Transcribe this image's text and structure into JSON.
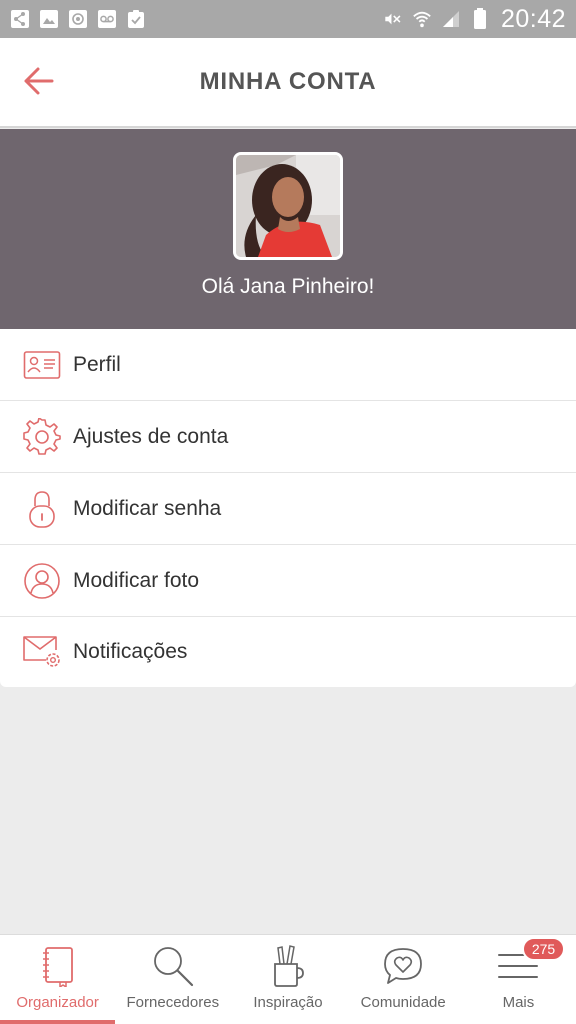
{
  "status_bar": {
    "time": "20:42",
    "left_icons": [
      "share-icon",
      "image-icon",
      "at-icon",
      "voicemail-icon",
      "clipboard-check-icon"
    ],
    "right_icons": [
      "mute-icon",
      "wifi-icon",
      "signal-icon",
      "battery-icon"
    ]
  },
  "header": {
    "title": "MINHA CONTA",
    "back_icon": "arrow-left-icon"
  },
  "profile": {
    "greeting": "Olá Jana Pinheiro!"
  },
  "menu": {
    "items": [
      {
        "label": "Perfil",
        "icon": "id-card-icon"
      },
      {
        "label": "Ajustes de conta",
        "icon": "gear-icon"
      },
      {
        "label": "Modificar senha",
        "icon": "lock-icon"
      },
      {
        "label": "Modificar foto",
        "icon": "user-circle-icon"
      },
      {
        "label": "Notificações",
        "icon": "mail-settings-icon"
      }
    ]
  },
  "bottom_nav": {
    "items": [
      {
        "label": "Organizador",
        "icon": "notebook-icon",
        "active": true
      },
      {
        "label": "Fornecedores",
        "icon": "search-icon"
      },
      {
        "label": "Inspiração",
        "icon": "pencil-cup-icon"
      },
      {
        "label": "Comunidade",
        "icon": "heart-chat-icon"
      },
      {
        "label": "Mais",
        "icon": "menu-icon",
        "badge": "275"
      }
    ]
  },
  "colors": {
    "accent": "#e06c6c",
    "banner": "#6f666e",
    "status_bar": "#a8a8a8",
    "background": "#ececec"
  }
}
